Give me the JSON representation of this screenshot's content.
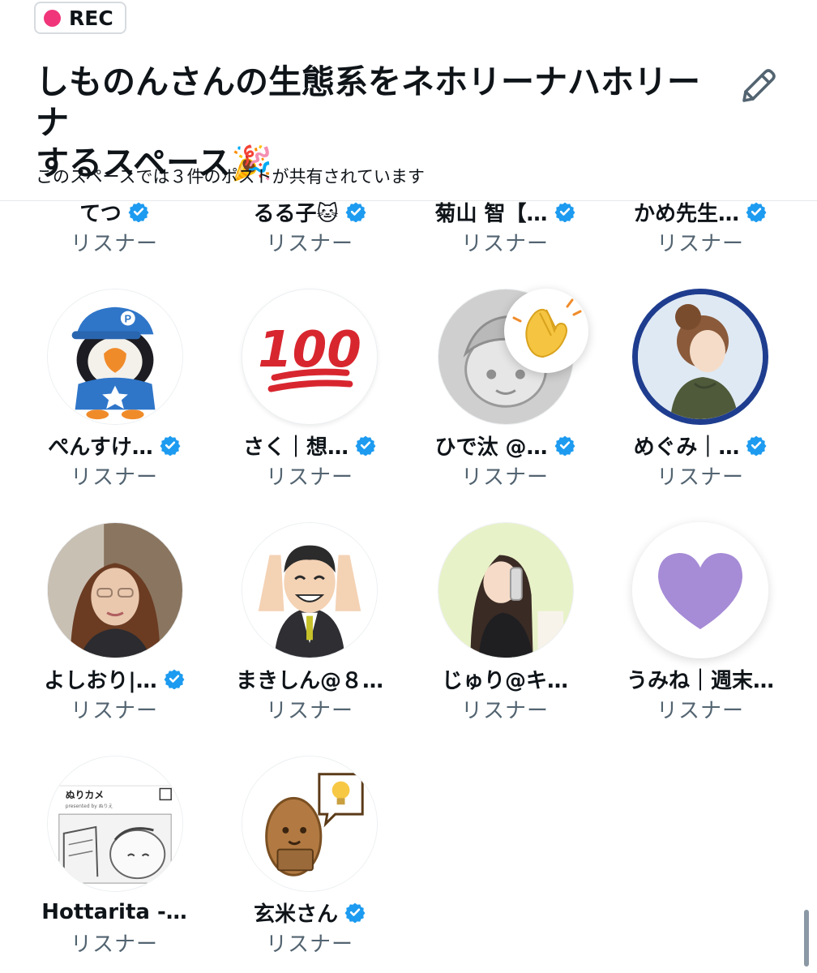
{
  "header": {
    "rec_label": "REC",
    "title_line1": "しものんさんの生態系をネホリーナハホリーナ",
    "title_line2": "するスペース🎉",
    "subtitle": "このスペースでは３件のポストが共有されています"
  },
  "colors": {
    "rec_dot": "#f0357a",
    "verified": "#1d9bf0",
    "role_text": "#536471",
    "heart": "#a68bd6"
  },
  "icons": {
    "edit": "pencil-icon",
    "verified": "verified-badge-icon",
    "clap": "clapping-hands-icon"
  },
  "listeners": [
    {
      "name": "てつ",
      "role": "リスナー",
      "verified": true
    },
    {
      "name": "るる子🐱",
      "role": "リスナー",
      "verified": true
    },
    {
      "name": "菊山 智【…",
      "role": "リスナー",
      "verified": true
    },
    {
      "name": "かめ先生…",
      "role": "リスナー",
      "verified": true
    },
    {
      "name": "ぺんすけ…",
      "role": "リスナー",
      "verified": true
    },
    {
      "name": "さく｜想…",
      "role": "リスナー",
      "verified": true
    },
    {
      "name": "ひで汰 @…",
      "role": "リスナー",
      "verified": true
    },
    {
      "name": "めぐみ｜…",
      "role": "リスナー",
      "verified": true
    },
    {
      "name": "よしおり|…",
      "role": "リスナー",
      "verified": true
    },
    {
      "name": "まきしん@８…",
      "role": "リスナー",
      "verified": false
    },
    {
      "name": "じゅり@キ…",
      "role": "リスナー",
      "verified": false
    },
    {
      "name": "うみね｜週末…",
      "role": "リスナー",
      "verified": false
    },
    {
      "name": "Hottarita -…",
      "role": "リスナー",
      "verified": false
    },
    {
      "name": "玄米さん",
      "role": "リスナー",
      "verified": true
    }
  ],
  "avatar_text": {
    "hundred": "100",
    "cap_letter": "P",
    "camera_brand": "ぬりカメ",
    "camera_sub": "presented by ぬりえ"
  }
}
